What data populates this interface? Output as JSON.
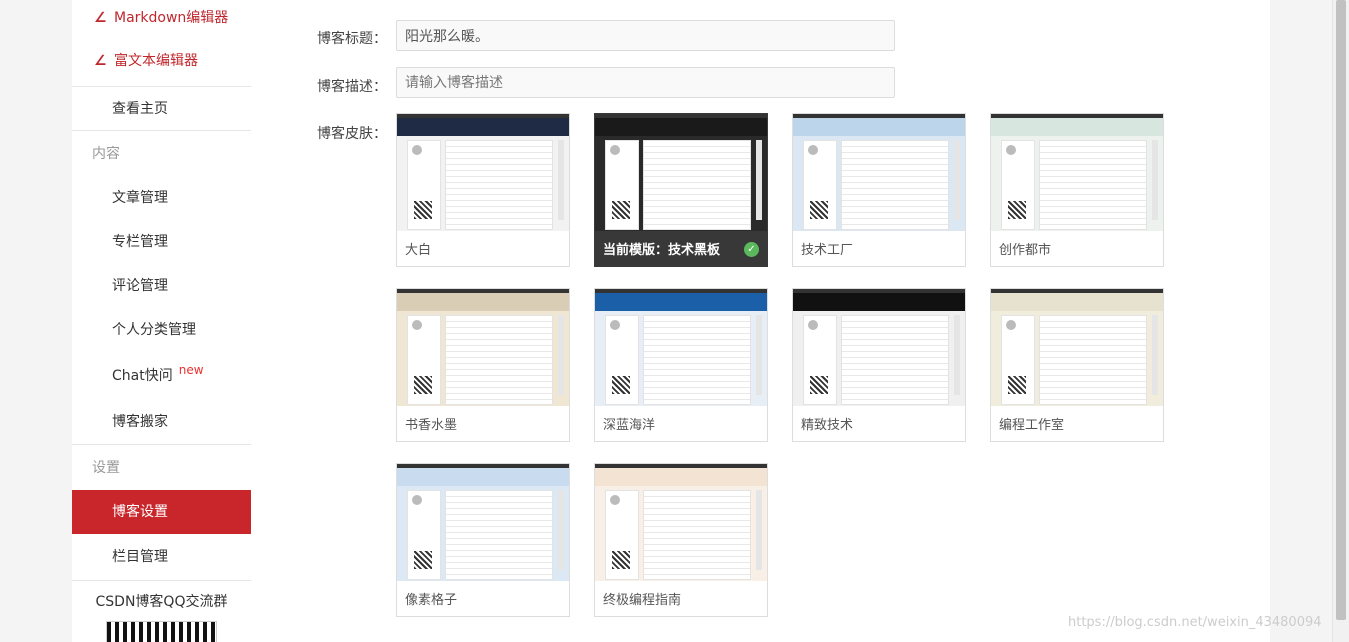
{
  "sidebar": {
    "editors": [
      "Markdown编辑器",
      "富文本编辑器"
    ],
    "home": "查看主页",
    "section_content": "内容",
    "content_items": [
      "文章管理",
      "专栏管理",
      "评论管理",
      "个人分类管理",
      "Chat快问",
      "博客搬家"
    ],
    "chat_badge": "new",
    "section_settings": "设置",
    "settings_items": [
      "博客设置",
      "栏目管理"
    ],
    "qq_group": "CSDN博客QQ交流群"
  },
  "form": {
    "title_label": "博客标题：",
    "title_value": "阳光那么暖。",
    "desc_label": "博客描述：",
    "desc_placeholder": "请输入博客描述",
    "skin_label": "博客皮肤："
  },
  "skins": [
    {
      "name": "大白",
      "banner": "#1f2a44",
      "bg": "#f2f2f2"
    },
    {
      "name": "当前模版：技术黑板",
      "banner": "#1a1a1a",
      "bg": "#2a2a2a",
      "current": true
    },
    {
      "name": "技术工厂",
      "banner": "#bcd5ea",
      "bg": "#dbe8f4"
    },
    {
      "name": "创作都市",
      "banner": "#d7e6df",
      "bg": "#eef2ef"
    },
    {
      "name": "书香水墨",
      "banner": "#d9cdb5",
      "bg": "#efe6d4"
    },
    {
      "name": "深蓝海洋",
      "banner": "#1b5fa8",
      "bg": "#e8eef5"
    },
    {
      "name": "精致技术",
      "banner": "#111111",
      "bg": "#f0f0f0"
    },
    {
      "name": "编程工作室",
      "banner": "#e6e2cf",
      "bg": "#f0eddd"
    },
    {
      "name": "像素格子",
      "banner": "#c9dcef",
      "bg": "#dce8f3"
    },
    {
      "name": "终极编程指南",
      "banner": "#f3e3d3",
      "bg": "#f8efe6"
    }
  ],
  "watermark": "https://blog.csdn.net/weixin_43480094"
}
